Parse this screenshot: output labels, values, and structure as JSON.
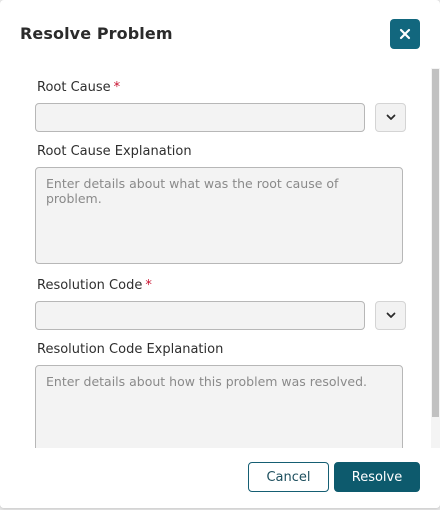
{
  "dialog": {
    "title": "Resolve Problem",
    "close_icon": "close-icon",
    "accent_color": "#12677e"
  },
  "form": {
    "root_cause": {
      "label": "Root Cause",
      "required_marker": "*",
      "value": "",
      "toggle_icon": "chevron-down-icon"
    },
    "root_cause_explanation": {
      "label": "Root Cause Explanation",
      "placeholder": "Enter details about what was the root cause of problem.",
      "value": ""
    },
    "resolution_code": {
      "label": "Resolution Code",
      "required_marker": "*",
      "value": "",
      "toggle_icon": "chevron-down-icon"
    },
    "resolution_code_explanation": {
      "label": "Resolution Code Explanation",
      "placeholder": "Enter details about how this problem was resolved.",
      "value": ""
    }
  },
  "footer": {
    "cancel_label": "Cancel",
    "resolve_label": "Resolve"
  }
}
